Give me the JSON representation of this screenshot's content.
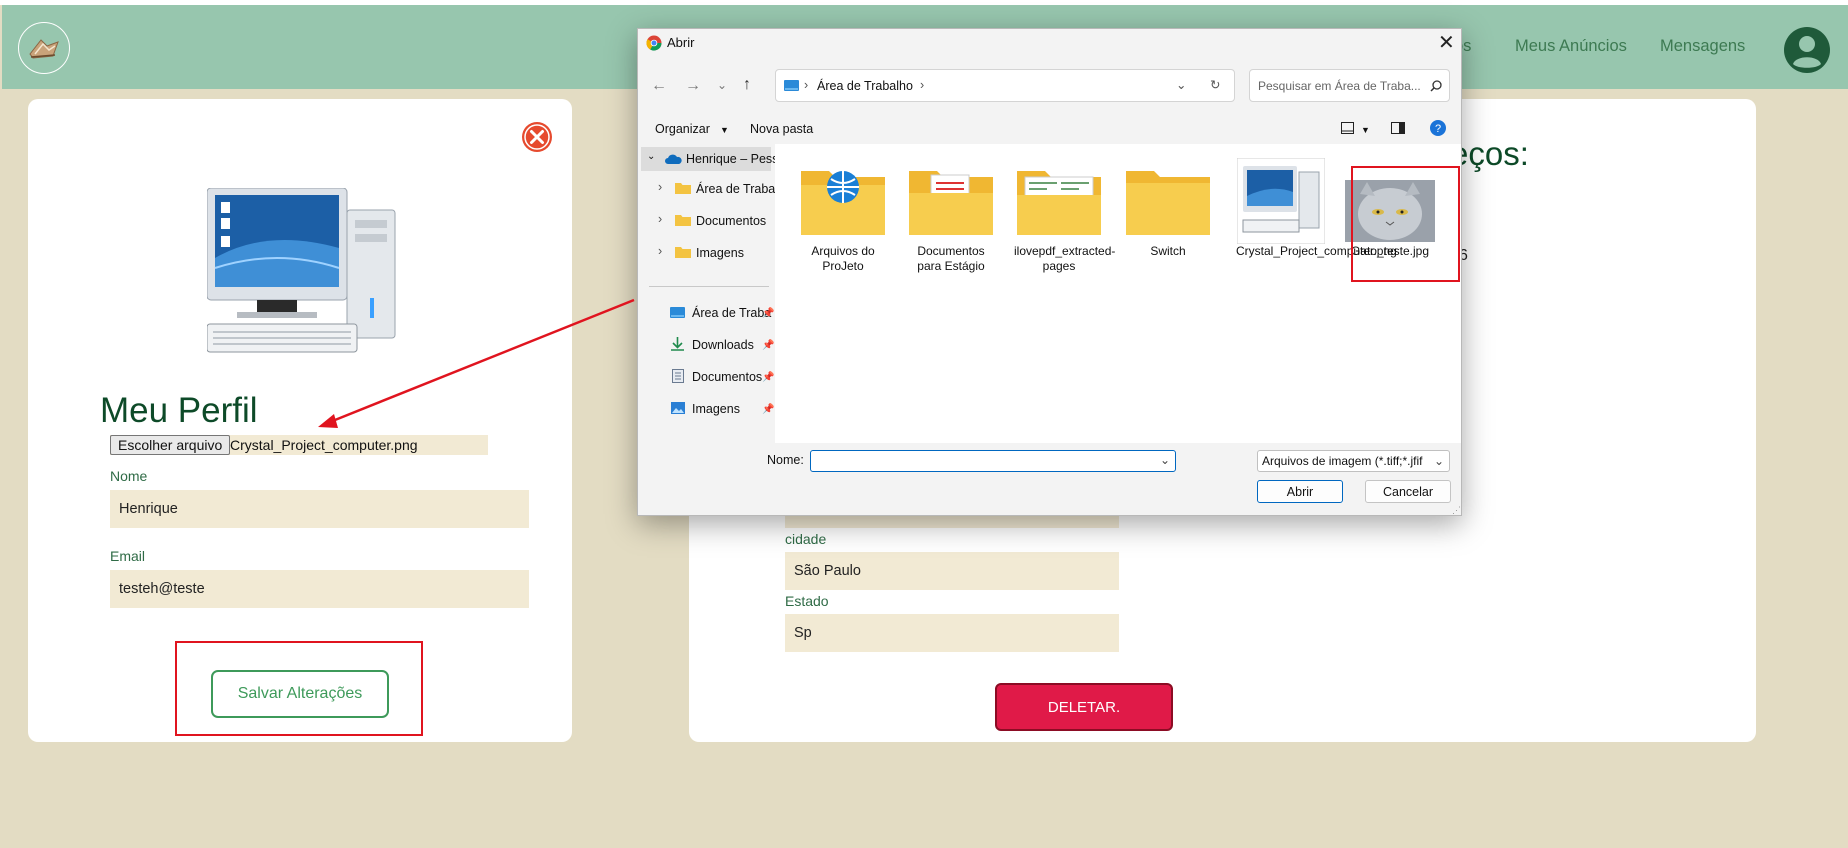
{
  "header": {
    "nav_partial": "os",
    "nav_my_ads": "Meus Anúncios",
    "nav_messages": "Mensagens"
  },
  "profile": {
    "title": "Meu Perfil",
    "file_button": "Escolher arquivo",
    "file_name": "Crystal_Project_computer.png",
    "name_label": "Nome",
    "name_value": "Henrique",
    "email_label": "Email",
    "email_value": "testeh@teste",
    "save_button": "Salvar Alterações"
  },
  "addresses": {
    "title_partial": "eços:",
    "number_partial": "6",
    "city_label": "cidade",
    "city_value": "São Paulo",
    "state_label": "Estado",
    "state_value": "Sp",
    "delete_button": "DELETAR."
  },
  "dialog": {
    "title": "Abrir",
    "breadcrumb": "Área de Trabalho",
    "search_placeholder": "Pesquisar em Área de Traba...",
    "organize": "Organizar",
    "new_folder": "Nova pasta",
    "sidebar": {
      "onedrive": "Henrique – Pess",
      "tree": [
        "Área de Traball",
        "Documentos",
        "Imagens"
      ],
      "quick": [
        "Área de Traba",
        "Downloads",
        "Documentos",
        "Imagens"
      ]
    },
    "files": [
      {
        "label": "Arquivos do ProJeto"
      },
      {
        "label": "Documentos para Estágio"
      },
      {
        "label": "ilovepdf_extracted-pages"
      },
      {
        "label": "Switch"
      },
      {
        "label": "Crystal_Project_computer.png"
      },
      {
        "label": "Gato_teste.jpg"
      }
    ],
    "name_label": "Nome:",
    "file_type": "Arquivos de imagem (*.tiff;*.jfif",
    "open_button": "Abrir",
    "cancel_button": "Cancelar"
  },
  "colors": {
    "header_bg": "#97c6ae",
    "page_bg": "#e3dcc3",
    "title_green": "#0d4a28",
    "accent_green": "#3e9a5a",
    "delete_red": "#e01a48",
    "annotation_red": "#e0141f"
  }
}
